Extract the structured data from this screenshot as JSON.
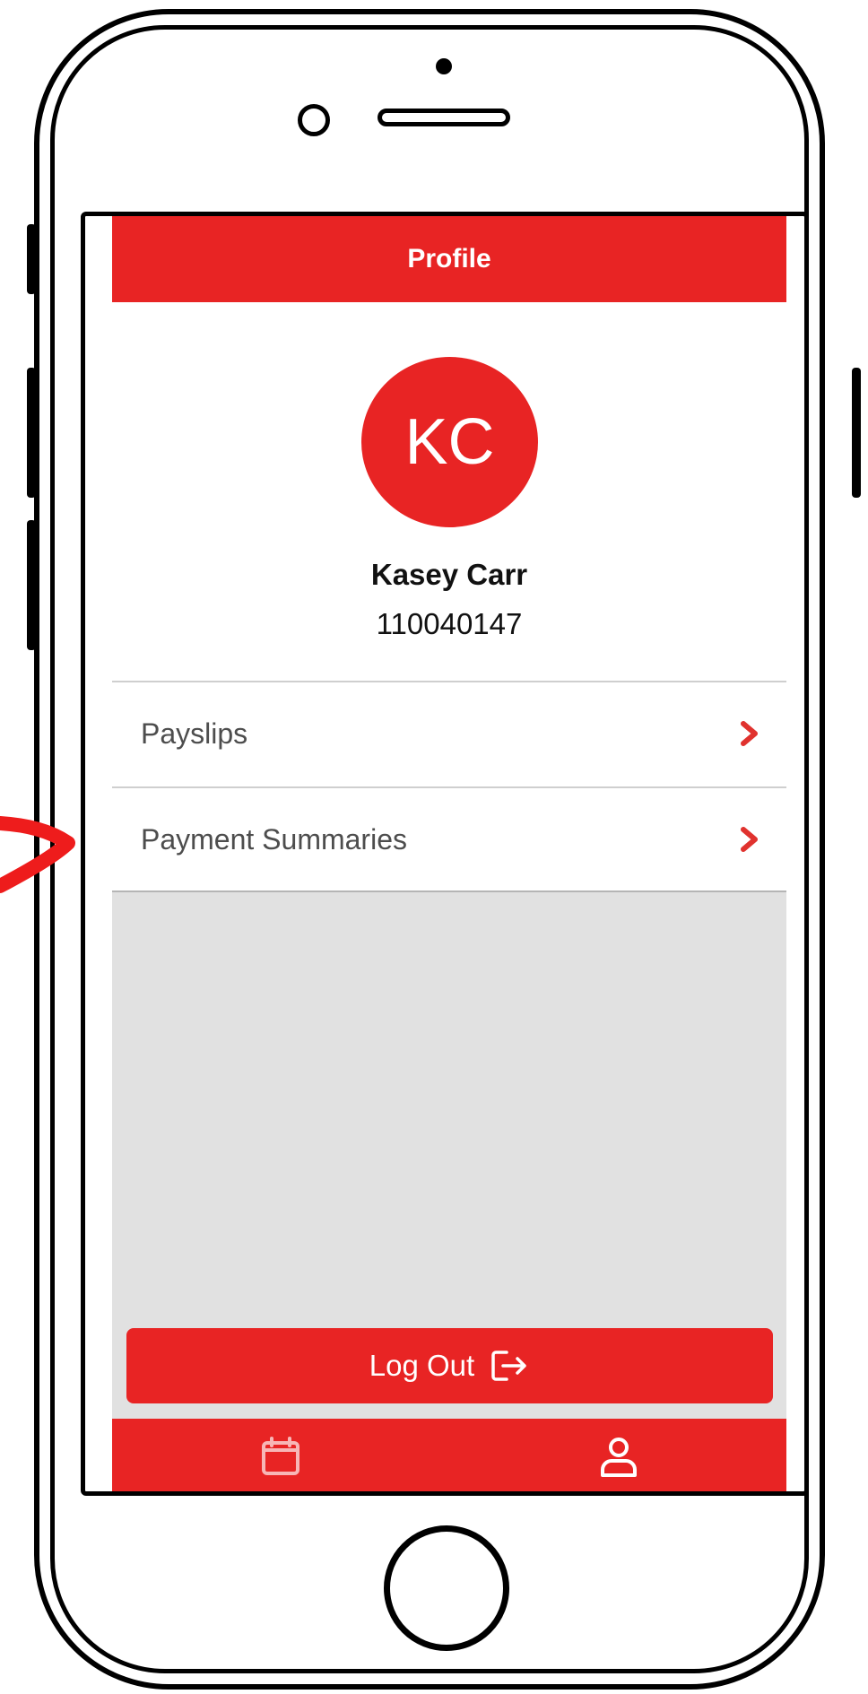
{
  "header": {
    "title": "Profile"
  },
  "profile": {
    "initials": "KC",
    "name": "Kasey Carr",
    "employee_id": "110040147"
  },
  "menu": {
    "items": [
      {
        "label": "Payslips",
        "icon": "chevron-right-icon"
      },
      {
        "label": "Payment Summaries",
        "icon": "chevron-right-icon"
      }
    ]
  },
  "logout": {
    "label": "Log Out",
    "icon": "logout-icon"
  },
  "tabbar": {
    "tabs": [
      {
        "icon": "calendar-icon"
      },
      {
        "icon": "user-icon"
      }
    ]
  },
  "colors": {
    "accent": "#e82424",
    "background_gray": "#e1e1e1",
    "label_gray": "#4d4d4d"
  }
}
